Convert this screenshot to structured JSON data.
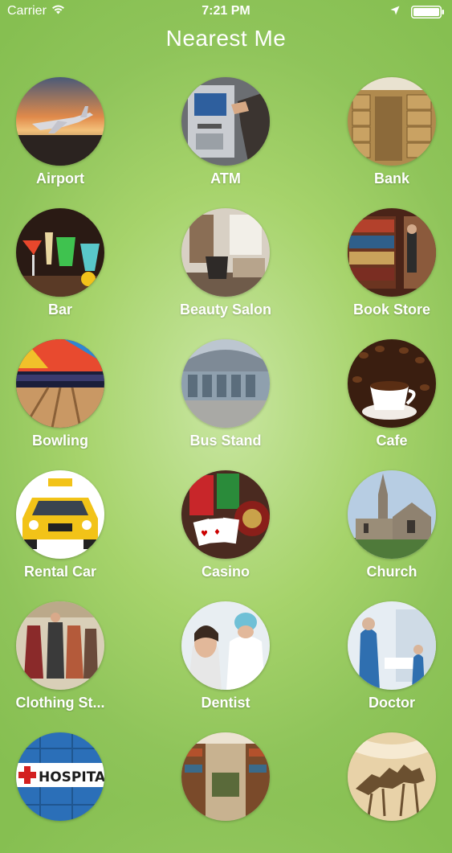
{
  "status_bar": {
    "carrier": "Carrier",
    "time": "7:21 PM",
    "wifi_icon": "wifi-icon",
    "location_icon": "location-arrow-icon",
    "battery_icon": "battery-icon"
  },
  "header": {
    "title": "Nearest Me"
  },
  "categories": [
    {
      "label": "Airport",
      "icon": "airplane-icon"
    },
    {
      "label": "ATM",
      "icon": "atm-icon"
    },
    {
      "label": "Bank",
      "icon": "bank-vault-icon"
    },
    {
      "label": "Bar",
      "icon": "cocktail-icon"
    },
    {
      "label": "Beauty Salon",
      "icon": "salon-chair-icon"
    },
    {
      "label": "Book Store",
      "icon": "bookshelf-icon"
    },
    {
      "label": "Bowling",
      "icon": "bowling-icon"
    },
    {
      "label": "Bus Stand",
      "icon": "bus-station-icon"
    },
    {
      "label": "Cafe",
      "icon": "coffee-cup-icon"
    },
    {
      "label": "Rental Car",
      "icon": "taxi-icon"
    },
    {
      "label": "Casino",
      "icon": "casino-chips-icon"
    },
    {
      "label": "Church",
      "icon": "church-icon"
    },
    {
      "label": "Clothing St...",
      "icon": "clothing-store-icon"
    },
    {
      "label": "Dentist",
      "icon": "dentist-icon"
    },
    {
      "label": "Doctor",
      "icon": "doctor-icon"
    },
    {
      "label": "",
      "icon": "hospital-icon",
      "image_text": "HOSPITAL"
    },
    {
      "label": "",
      "icon": "library-icon"
    },
    {
      "label": "",
      "icon": "museum-icon"
    }
  ],
  "colors": {
    "background_center": "#c9e6a1",
    "background_edge": "#86bf51",
    "text": "#ffffff"
  }
}
